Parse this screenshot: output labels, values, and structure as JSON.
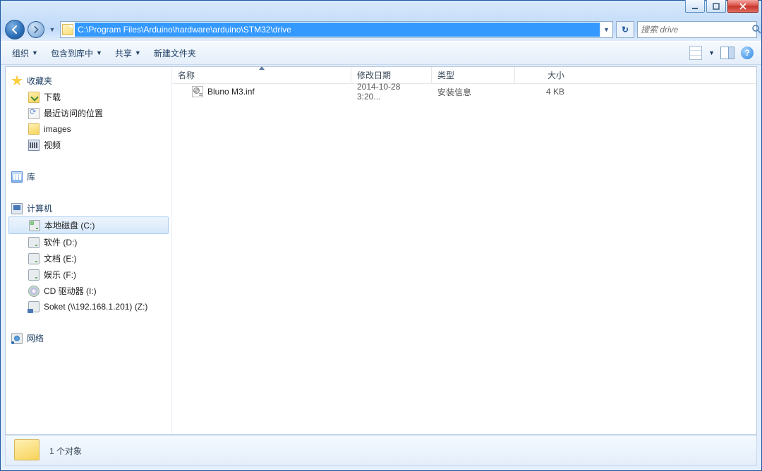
{
  "titlebar": {
    "min": "–",
    "max": "❐",
    "close": "✕"
  },
  "address_path": "C:\\Program Files\\Arduino\\hardware\\arduino\\STM32\\drive",
  "search_placeholder": "搜索 drive",
  "toolbar": {
    "organize": "组织",
    "include": "包含到库中",
    "share": "共享",
    "newfolder": "新建文件夹"
  },
  "navpane": {
    "favorites": "收藏夹",
    "fav_items": {
      "downloads": "下载",
      "recent": "最近访问的位置",
      "images": "images",
      "videos": "视频"
    },
    "libraries": "库",
    "computer": "计算机",
    "drives": {
      "c": "本地磁盘 (C:)",
      "d": "软件 (D:)",
      "e": "文档 (E:)",
      "f": "娱乐 (F:)",
      "cd": "CD 驱动器 (I:)",
      "z": "Soket (\\\\192.168.1.201) (Z:)"
    },
    "network": "网络"
  },
  "columns": {
    "name": "名称",
    "date": "修改日期",
    "type": "类型",
    "size": "大小"
  },
  "files": [
    {
      "name": "Bluno M3.inf",
      "date": "2014-10-28 3:20...",
      "type": "安装信息",
      "size": "4 KB"
    }
  ],
  "status": "1 个对象"
}
